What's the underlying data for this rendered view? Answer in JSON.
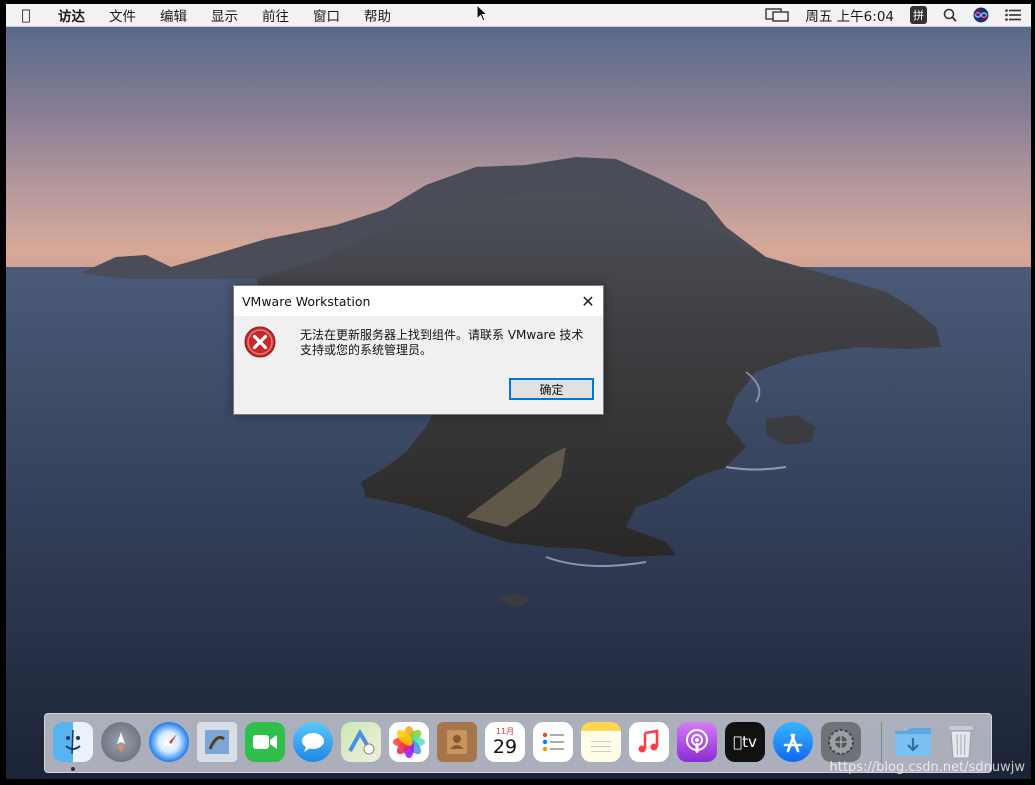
{
  "menubar": {
    "items": [
      "访达",
      "文件",
      "编辑",
      "显示",
      "前往",
      "窗口",
      "帮助"
    ],
    "clock": "周五 上午6:04",
    "ime": "拼"
  },
  "dialog": {
    "title": "VMware Workstation",
    "message": "无法在更新服务器上找到组件。请联系 VMware 技术支持或您的系统管理员。",
    "ok_label": "确定",
    "close_glyph": "✕"
  },
  "dock": {
    "calendar_month": "11月",
    "calendar_day": "29",
    "tv_label": "tv"
  },
  "watermark": "https://blog.csdn.net/sdnuwjw",
  "colors": {
    "accent": "#0078d7",
    "error_red": "#d32f2f"
  }
}
